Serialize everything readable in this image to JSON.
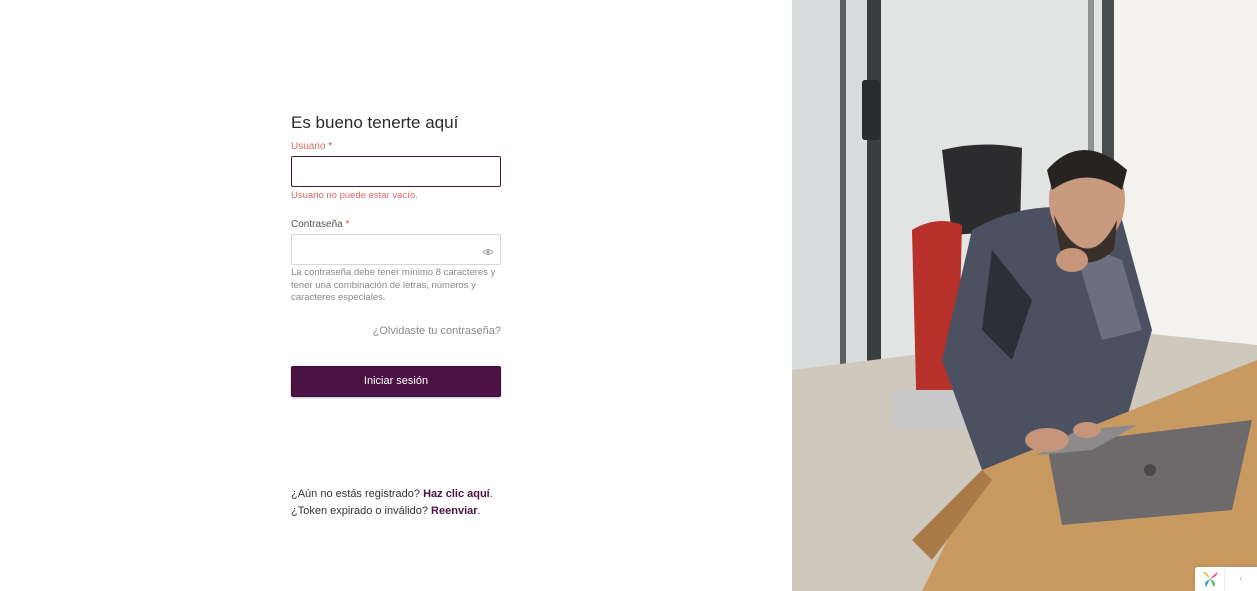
{
  "login": {
    "title": "Es bueno tenerte aquí",
    "username_label": "Usuario",
    "required_mark": "*",
    "username_value": "",
    "username_error": "Usuario no puede estar vacío.",
    "password_label": "Contraseña",
    "password_value": "",
    "password_hint": "La contraseña debe tener mínimo 8 caracteres y tener una combinación de letras, números y caracteres especiales.",
    "forgot_link": "¿Olvidaste tu contraseña?",
    "submit_label": "Iniciar sesión"
  },
  "footer": {
    "register_text": "¿Aún no estás registrado?",
    "register_link": "Haz clic aquí",
    "token_text": "¿Token expirado o inválido?",
    "resend_link": "Reenviar"
  },
  "colors": {
    "brand": "#4a1245",
    "error": "#e06a6a"
  },
  "icons": {
    "password_toggle": "eye-icon",
    "widget": "flower-logo-icon",
    "widget_toggle": "chevron-left-icon"
  }
}
